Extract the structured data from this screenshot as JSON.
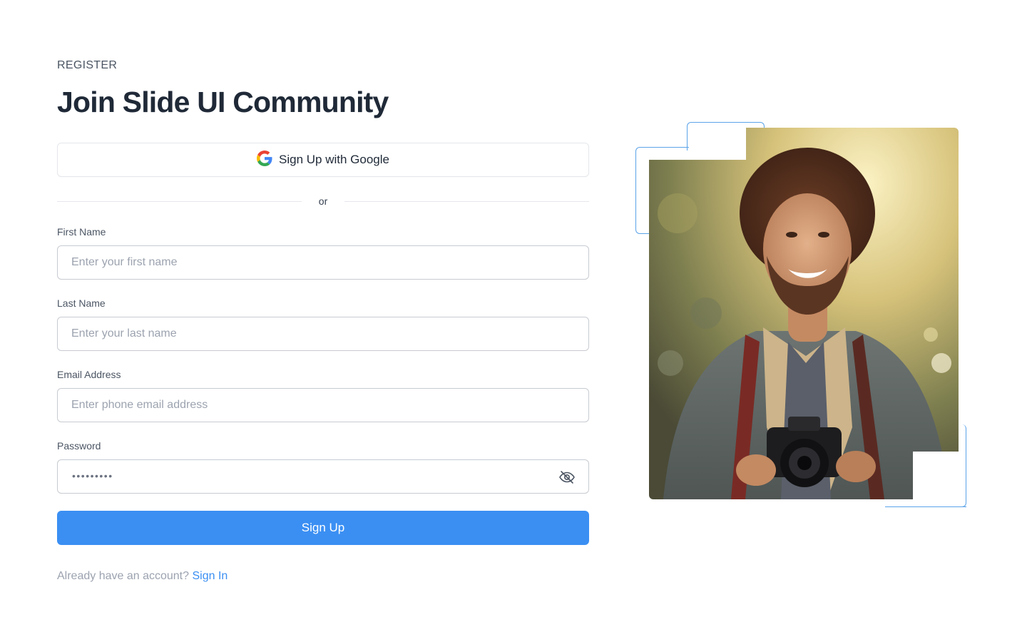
{
  "header": {
    "eyebrow": "REGISTER",
    "title": "Join Slide UI Community"
  },
  "google": {
    "label": "Sign Up with Google",
    "icon": "google-icon"
  },
  "divider": {
    "label": "or"
  },
  "fields": {
    "first_name": {
      "label": "First Name",
      "placeholder": "Enter your first name",
      "value": ""
    },
    "last_name": {
      "label": "Last Name",
      "placeholder": "Enter your last name",
      "value": ""
    },
    "email": {
      "label": "Email Address",
      "placeholder": "Enter phone email address",
      "value": ""
    },
    "password": {
      "label": "Password",
      "masked_value": "•••••••••",
      "toggle_icon": "eye-off-icon"
    }
  },
  "submit": {
    "label": "Sign Up"
  },
  "footer": {
    "prompt": "Already have an account?",
    "link": "Sign In"
  },
  "colors": {
    "accent": "#3b8ff3",
    "frame": "#5aa3e8",
    "text": "#1f2937",
    "muted": "#9ca3af"
  },
  "image": {
    "subject": "smiling-man-with-camera-photo"
  }
}
